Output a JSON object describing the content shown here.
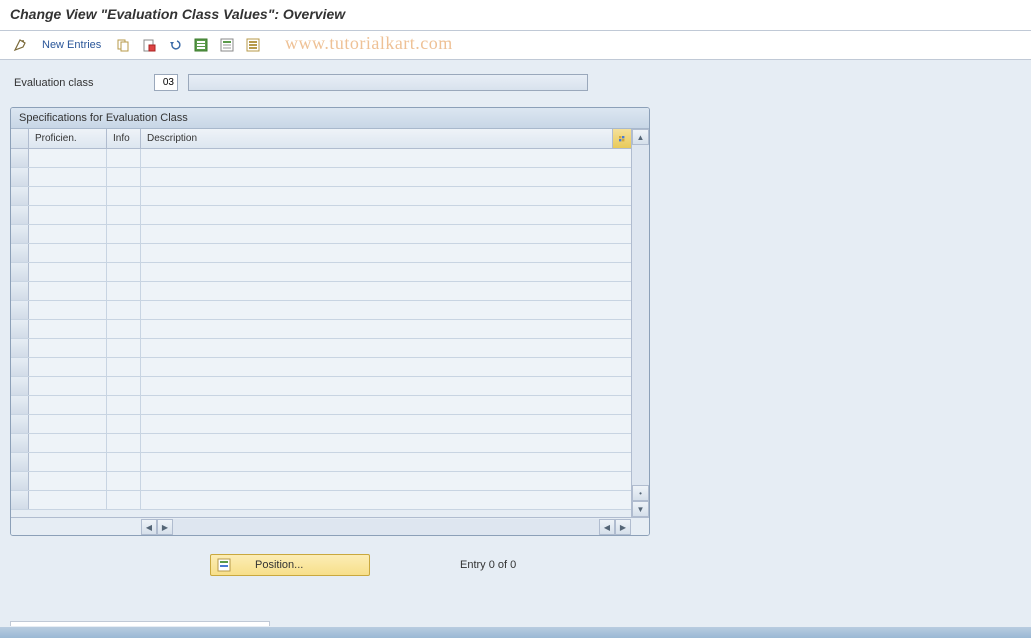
{
  "title": "Change View \"Evaluation Class Values\": Overview",
  "toolbar": {
    "new_entries": "New Entries"
  },
  "watermark": "www.tutorialkart.com",
  "fields": {
    "evaluation_class_label": "Evaluation class",
    "evaluation_class_value": "03",
    "evaluation_class_desc": ""
  },
  "table": {
    "title": "Specifications for Evaluation Class",
    "columns": {
      "proficien": "Proficien.",
      "info": "Info",
      "description": "Description"
    },
    "rows": [
      {
        "proficien": "",
        "info": "",
        "description": ""
      },
      {
        "proficien": "",
        "info": "",
        "description": ""
      },
      {
        "proficien": "",
        "info": "",
        "description": ""
      },
      {
        "proficien": "",
        "info": "",
        "description": ""
      },
      {
        "proficien": "",
        "info": "",
        "description": ""
      },
      {
        "proficien": "",
        "info": "",
        "description": ""
      },
      {
        "proficien": "",
        "info": "",
        "description": ""
      },
      {
        "proficien": "",
        "info": "",
        "description": ""
      },
      {
        "proficien": "",
        "info": "",
        "description": ""
      },
      {
        "proficien": "",
        "info": "",
        "description": ""
      },
      {
        "proficien": "",
        "info": "",
        "description": ""
      },
      {
        "proficien": "",
        "info": "",
        "description": ""
      },
      {
        "proficien": "",
        "info": "",
        "description": ""
      },
      {
        "proficien": "",
        "info": "",
        "description": ""
      },
      {
        "proficien": "",
        "info": "",
        "description": ""
      },
      {
        "proficien": "",
        "info": "",
        "description": ""
      },
      {
        "proficien": "",
        "info": "",
        "description": ""
      },
      {
        "proficien": "",
        "info": "",
        "description": ""
      },
      {
        "proficien": "",
        "info": "",
        "description": ""
      }
    ]
  },
  "footer": {
    "position_label": "Position...",
    "entry_text": "Entry 0 of 0"
  }
}
